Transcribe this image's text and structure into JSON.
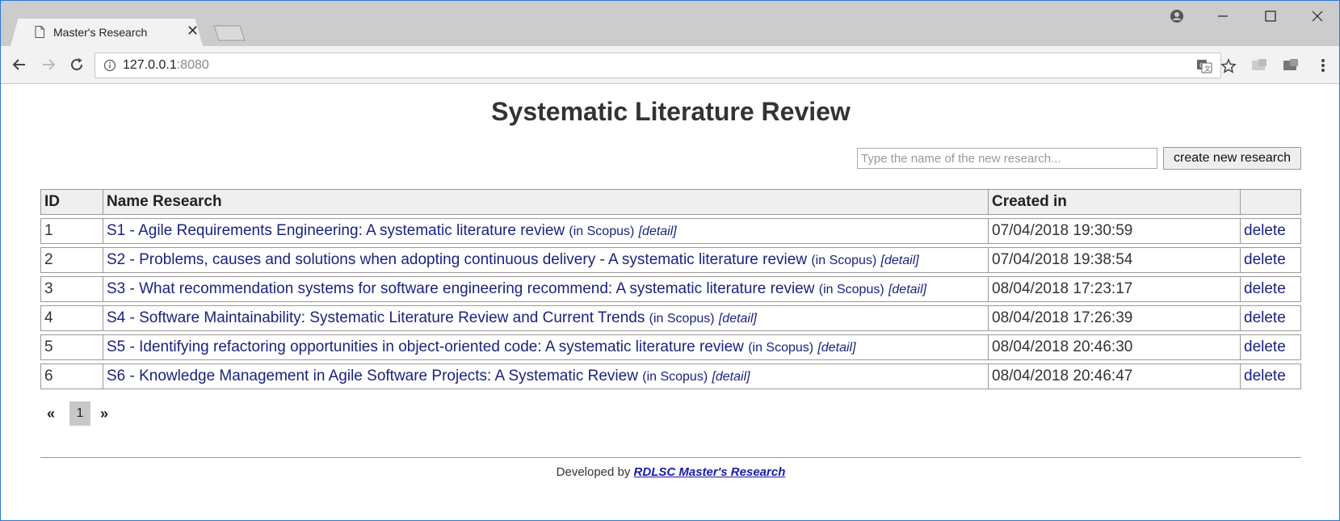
{
  "browser": {
    "tab_title": "Master's Research",
    "url_host": "127.0.0.1",
    "url_port": ":8080"
  },
  "page": {
    "title": "Systematic Literature Review",
    "new_research_placeholder": "Type the name of the new research...",
    "create_button_label": "create new research",
    "table": {
      "headers": [
        "ID",
        "Name Research",
        "Created in",
        ""
      ],
      "rows": [
        {
          "id": "1",
          "name": "S1 - Agile Requirements Engineering: A systematic literature review",
          "source": "(in Scopus)",
          "detail": "[detail]",
          "created": "07/04/2018 19:30:59",
          "action": "delete"
        },
        {
          "id": "2",
          "name": "S2 - Problems, causes and solutions when adopting continuous delivery - A systematic literature review",
          "source": "(in Scopus)",
          "detail": "[detail]",
          "created": "07/04/2018 19:38:54",
          "action": "delete"
        },
        {
          "id": "3",
          "name": "S3 - What recommendation systems for software engineering recommend: A systematic literature review",
          "source": "(in Scopus)",
          "detail": "[detail]",
          "created": "08/04/2018 17:23:17",
          "action": "delete"
        },
        {
          "id": "4",
          "name": "S4 - Software Maintainability: Systematic Literature Review and Current Trends",
          "source": "(in Scopus)",
          "detail": "[detail]",
          "created": "08/04/2018 17:26:39",
          "action": "delete"
        },
        {
          "id": "5",
          "name": "S5 - Identifying refactoring opportunities in object-oriented code: A systematic literature review",
          "source": "(in Scopus)",
          "detail": "[detail]",
          "created": "08/04/2018 20:46:30",
          "action": "delete"
        },
        {
          "id": "6",
          "name": "S6 - Knowledge Management in Agile Software Projects: A Systematic Review",
          "source": "(in Scopus)",
          "detail": "[detail]",
          "created": "08/04/2018 20:46:47",
          "action": "delete"
        }
      ]
    },
    "pagination": {
      "prev": "«",
      "current": "1",
      "next": "»"
    },
    "footer": {
      "prefix": "Developed by",
      "link_text": "RDLSC Master's Research"
    }
  }
}
